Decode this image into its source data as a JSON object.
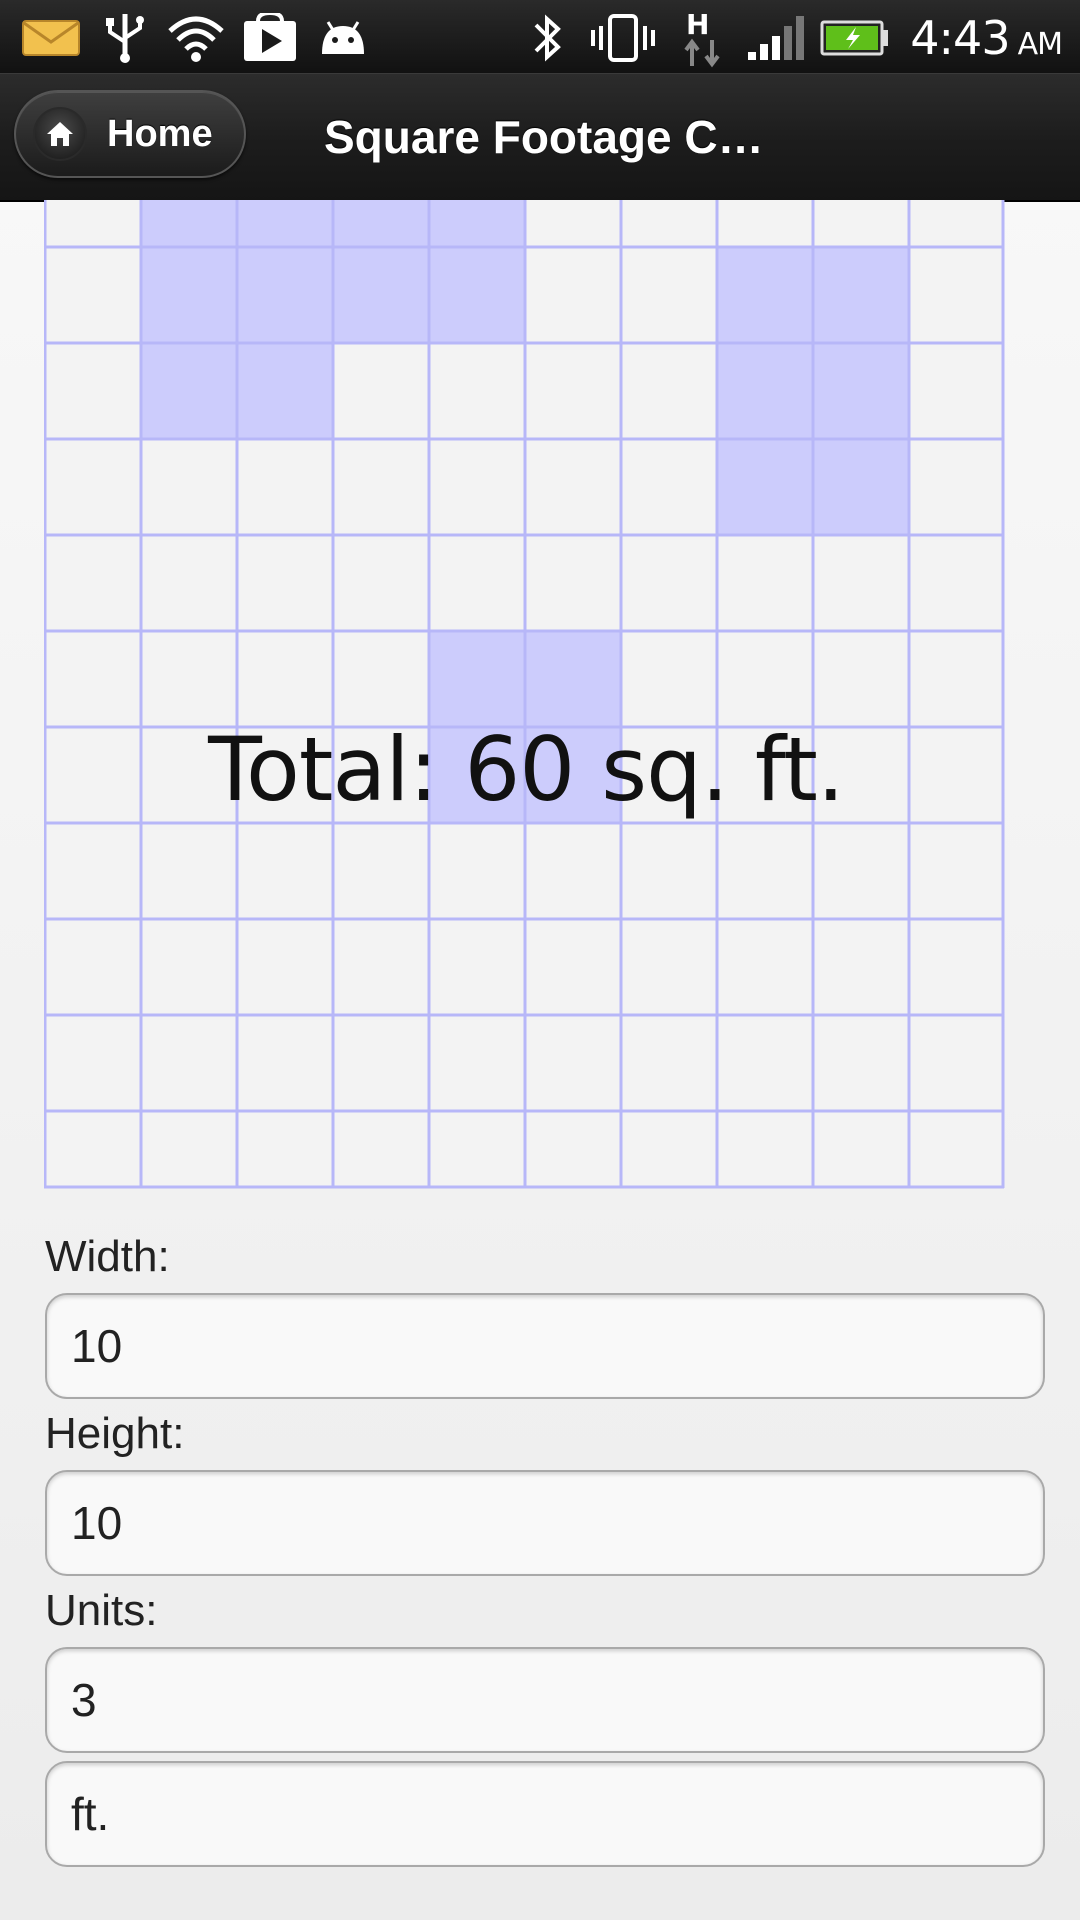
{
  "status_bar": {
    "time": "4:43",
    "ampm": "AM",
    "icons": [
      "mail-icon",
      "usb-icon",
      "wifi-icon",
      "play-store-icon",
      "android-icon",
      "bluetooth-icon",
      "vibrate-icon",
      "data-h-icon",
      "signal-icon",
      "battery-charging-icon"
    ],
    "colors": {
      "battery": "#5fbf1a",
      "background": "#1a1a1a"
    }
  },
  "action_bar": {
    "home_label": "Home",
    "title": "Square Footage C…"
  },
  "grid": {
    "columns": 10,
    "rows_visible": 8.4,
    "line_color": "#b7b7f8",
    "fill_color": "#ccccfc",
    "filled_cells": [
      [
        1,
        0
      ],
      [
        2,
        0
      ],
      [
        3,
        0
      ],
      [
        4,
        0
      ],
      [
        1,
        1
      ],
      [
        2,
        1
      ],
      [
        3,
        1
      ],
      [
        4,
        1
      ],
      [
        7,
        1
      ],
      [
        8,
        1
      ],
      [
        1,
        2
      ],
      [
        2,
        2
      ],
      [
        7,
        2
      ],
      [
        8,
        2
      ],
      [
        7,
        3
      ],
      [
        8,
        3
      ],
      [
        4,
        5
      ],
      [
        5,
        5
      ],
      [
        4,
        6
      ],
      [
        5,
        6
      ]
    ],
    "total_label": "Total: 60 sq. ft."
  },
  "form": {
    "width_label": "Width:",
    "width_value": "10",
    "height_label": "Height:",
    "height_value": "10",
    "units_label": "Units:",
    "units_value": "3",
    "unit_name": "ft."
  }
}
